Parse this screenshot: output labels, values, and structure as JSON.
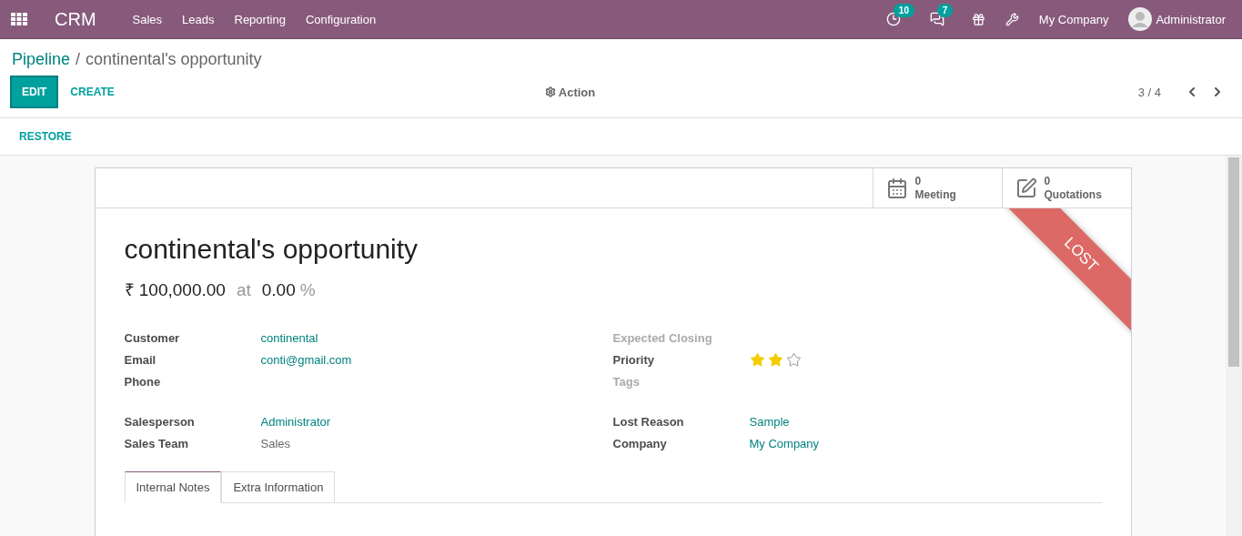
{
  "navbar": {
    "app": "CRM",
    "menu": [
      "Sales",
      "Leads",
      "Reporting",
      "Configuration"
    ],
    "activity_count": "10",
    "message_count": "7",
    "company": "My Company",
    "user": "Administrator"
  },
  "breadcrumb": {
    "parent": "Pipeline",
    "separator": "/",
    "current": "continental's opportunity"
  },
  "buttons": {
    "edit": "EDIT",
    "create": "CREATE",
    "action": "Action",
    "restore": "RESTORE"
  },
  "pager": "3 / 4",
  "smart_buttons": [
    {
      "count": "0",
      "label": "Meeting",
      "kind": "calendar"
    },
    {
      "count": "0",
      "label": "Quotations",
      "kind": "edit"
    }
  ],
  "ribbon": "LOST",
  "title": "continental's opportunity",
  "revenue": "₹ 100,000.00",
  "at": "at",
  "probability": "0.00",
  "percent": "%",
  "left_column": [
    [
      {
        "label": "Customer",
        "muted": false,
        "kind": "link",
        "value": "continental"
      },
      {
        "label": "Email",
        "muted": false,
        "kind": "link",
        "value": "conti@gmail.com"
      },
      {
        "label": "Phone",
        "muted": false,
        "kind": "empty"
      }
    ],
    [
      {
        "label": "Salesperson",
        "muted": false,
        "kind": "link",
        "value": "Administrator"
      },
      {
        "label": "Sales Team",
        "muted": false,
        "kind": "text",
        "value": "Sales"
      }
    ]
  ],
  "right_column": [
    [
      {
        "label": "Expected Closing",
        "muted": true,
        "kind": "empty"
      },
      {
        "label": "Priority",
        "muted": false,
        "kind": "stars",
        "stars": 2
      },
      {
        "label": "Tags",
        "muted": true,
        "kind": "empty"
      }
    ],
    [
      {
        "label": "Lost Reason",
        "muted": false,
        "kind": "link",
        "value": "Sample"
      },
      {
        "label": "Company",
        "muted": false,
        "kind": "link",
        "value": "My Company"
      }
    ]
  ],
  "tabs": [
    {
      "label": "Internal Notes",
      "selected": true
    },
    {
      "label": "Extra Information",
      "selected": false
    }
  ]
}
